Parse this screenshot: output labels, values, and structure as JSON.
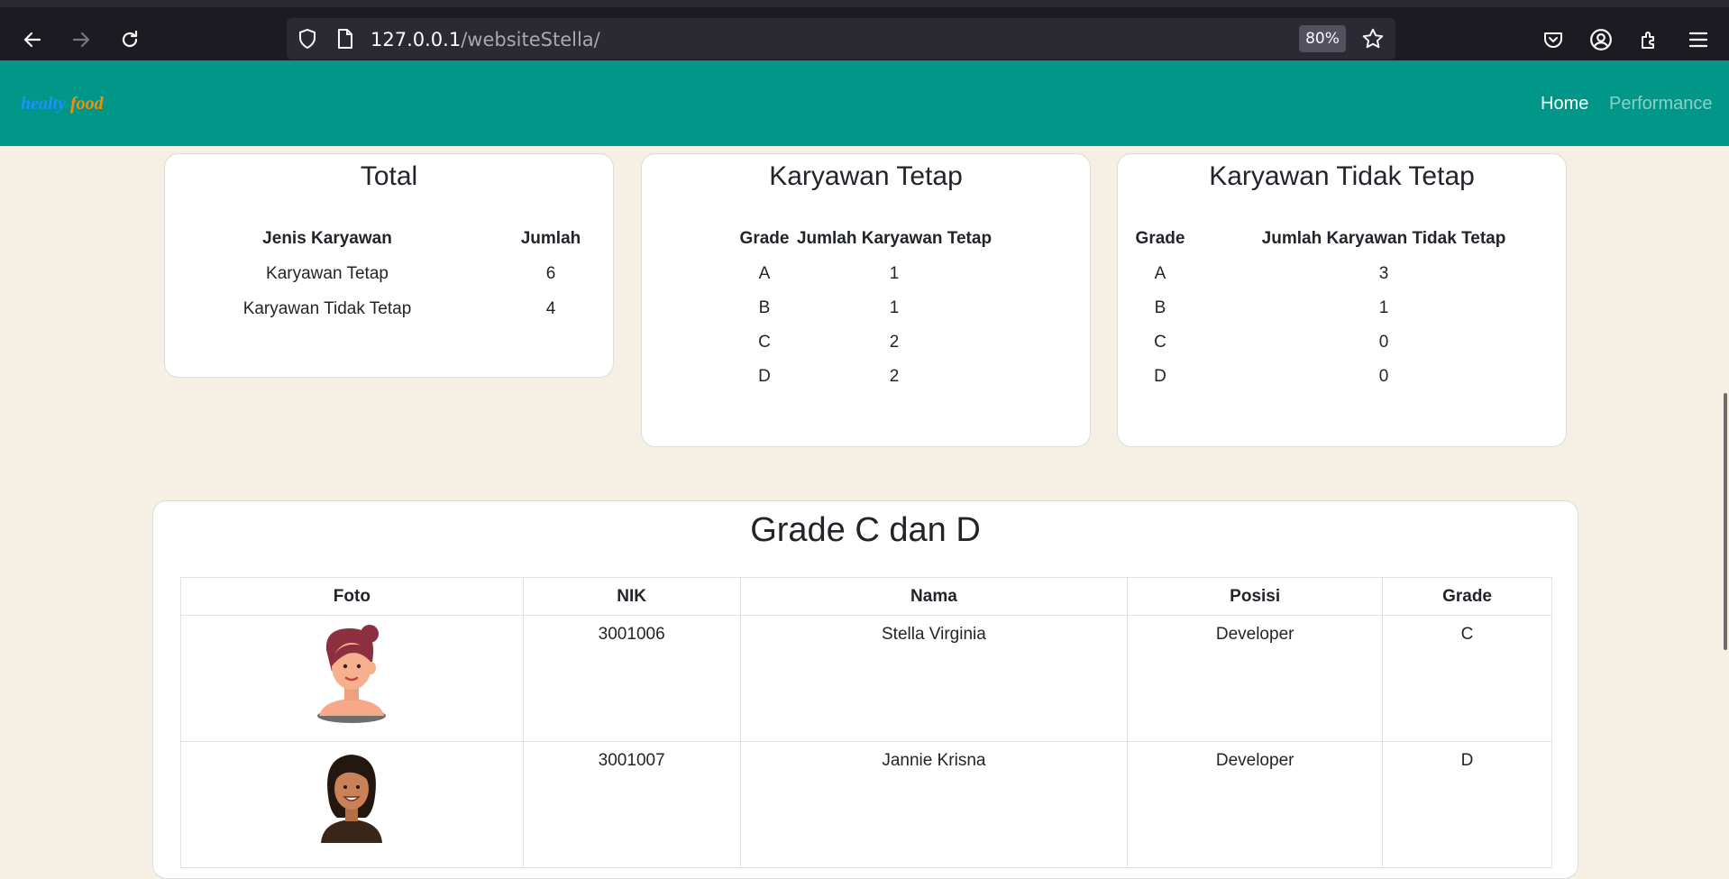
{
  "browser": {
    "url_host": "127.0.0.1",
    "url_path": "/websiteStella/",
    "zoom": "80%"
  },
  "navbar": {
    "brand_part1": "healty",
    "brand_part2": "food",
    "links": [
      "Home",
      "Performance"
    ]
  },
  "total": {
    "title": "Total",
    "headers": [
      "Jenis Karyawan",
      "Jumlah"
    ],
    "rows": [
      {
        "type": "Karyawan Tetap",
        "count": "6"
      },
      {
        "type": "Karyawan Tidak Tetap",
        "count": "4"
      }
    ]
  },
  "tetap": {
    "title": "Karyawan Tetap",
    "headers": [
      "Grade",
      "Jumlah Karyawan Tetap"
    ],
    "rows": [
      {
        "grade": "A",
        "count": "1"
      },
      {
        "grade": "B",
        "count": "1"
      },
      {
        "grade": "C",
        "count": "2"
      },
      {
        "grade": "D",
        "count": "2"
      }
    ]
  },
  "tidak_tetap": {
    "title": "Karyawan Tidak Tetap",
    "headers": [
      "Grade",
      "Jumlah Karyawan Tidak Tetap"
    ],
    "rows": [
      {
        "grade": "A",
        "count": "3"
      },
      {
        "grade": "B",
        "count": "1"
      },
      {
        "grade": "C",
        "count": "0"
      },
      {
        "grade": "D",
        "count": "0"
      }
    ]
  },
  "grade_cd": {
    "title": "Grade C dan D",
    "headers": [
      "Foto",
      "NIK",
      "Nama",
      "Posisi",
      "Grade"
    ],
    "rows": [
      {
        "nik": "3001006",
        "nama": "Stella Virginia",
        "posisi": "Developer",
        "grade": "C",
        "avatar": "woman-pink-hair-avatar"
      },
      {
        "nik": "3001007",
        "nama": "Jannie Krisna",
        "posisi": "Developer",
        "grade": "D",
        "avatar": "woman-dark-hair-avatar"
      }
    ]
  },
  "colors": {
    "navbar": "#009688",
    "page_bg": "#f6efe4",
    "brand_blue": "#1e90ff",
    "brand_orange": "#ff8c00"
  }
}
